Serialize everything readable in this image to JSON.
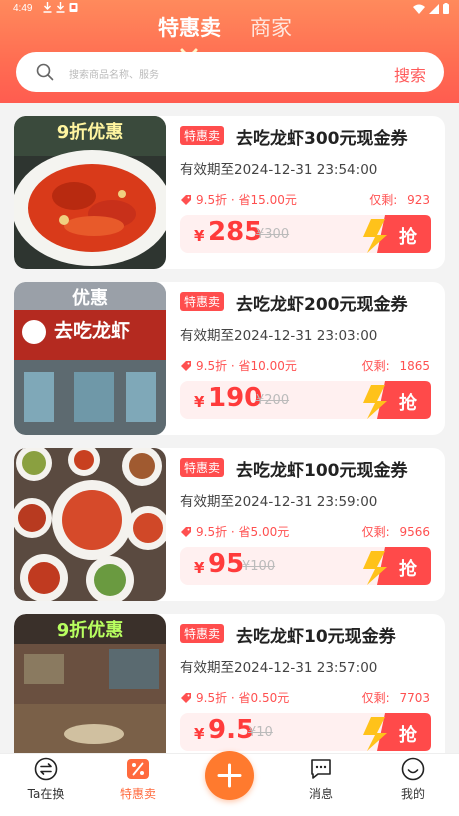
{
  "status_bar": {
    "time": "4:49"
  },
  "header": {
    "tabs": [
      {
        "label": "特惠卖",
        "active": true
      },
      {
        "label": "商家",
        "active": false
      }
    ]
  },
  "search": {
    "placeholder": "搜索商品名称、服务",
    "button_label": "搜索"
  },
  "colors": {
    "accent": "#ff5050",
    "header": "#ff6d52",
    "fab": "#ff7a2e"
  },
  "deals": [
    {
      "image_text": "9折优惠",
      "tag": "特惠卖",
      "title": "去吃龙虾300元现金券",
      "validity": "有效期至2024-12-31 23:54:00",
      "discount": "9.5折 · 省15.00元",
      "remain_label": "仅剩:",
      "remain_count": "923",
      "currency": "¥",
      "price": "285",
      "original_price": "¥300",
      "grab_label": "抢"
    },
    {
      "image_text": "优惠",
      "image_sign": "去吃龙虾",
      "tag": "特惠卖",
      "title": "去吃龙虾200元现金券",
      "validity": "有效期至2024-12-31 23:03:00",
      "discount": "9.5折 · 省10.00元",
      "remain_label": "仅剩:",
      "remain_count": "1865",
      "currency": "¥",
      "price": "190",
      "original_price": "¥200",
      "grab_label": "抢"
    },
    {
      "tag": "特惠卖",
      "title": "去吃龙虾100元现金券",
      "validity": "有效期至2024-12-31 23:59:00",
      "discount": "9.5折 · 省5.00元",
      "remain_label": "仅剩:",
      "remain_count": "9566",
      "currency": "¥",
      "price": "95",
      "original_price": "¥100",
      "grab_label": "抢"
    },
    {
      "image_text": "9折优惠",
      "tag": "特惠卖",
      "title": "去吃龙虾10元现金券",
      "validity": "有效期至2024-12-31 23:57:00",
      "discount": "9.5折 · 省0.50元",
      "remain_label": "仅剩:",
      "remain_count": "7703",
      "currency": "¥",
      "price": "9.5",
      "original_price": "¥10",
      "grab_label": "抢"
    }
  ],
  "bottom_nav": {
    "items": [
      {
        "label": "Ta在换",
        "icon": "exchange-icon"
      },
      {
        "label": "特惠卖",
        "icon": "discount-icon",
        "active": true
      },
      {
        "label": "",
        "icon": "plus-icon"
      },
      {
        "label": "消息",
        "icon": "message-icon"
      },
      {
        "label": "我的",
        "icon": "profile-icon"
      }
    ]
  }
}
